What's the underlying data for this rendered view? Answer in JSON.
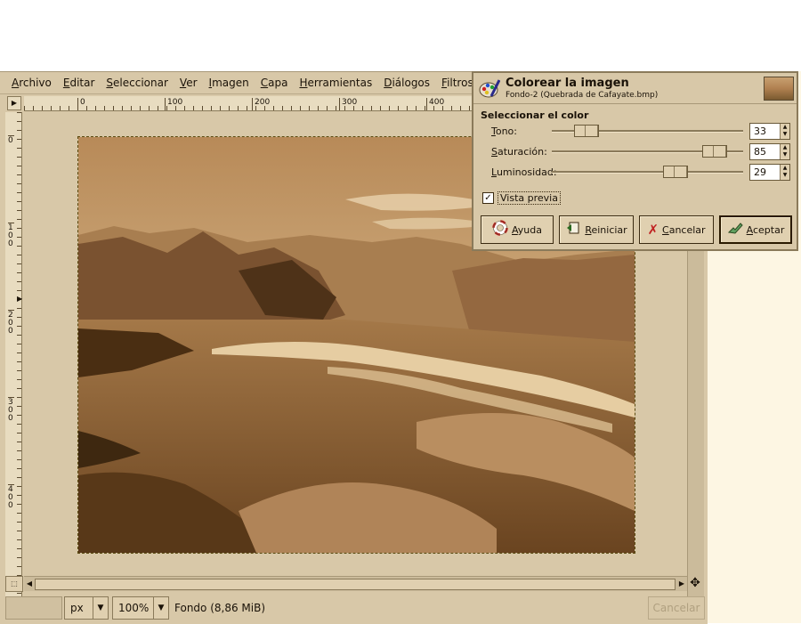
{
  "menubar": {
    "items": [
      "Archivo",
      "Editar",
      "Seleccionar",
      "Ver",
      "Imagen",
      "Capa",
      "Herramientas",
      "Diálogos",
      "Filtros"
    ]
  },
  "rulers": {
    "horizontal": [
      "0",
      "100",
      "200",
      "300",
      "400"
    ],
    "vertical": [
      "0",
      "100",
      "200",
      "300",
      "400"
    ]
  },
  "statusbar": {
    "unit": "px",
    "zoom": "100%",
    "message": "Fondo (8,86 MiB)",
    "cancel_label": "Cancelar"
  },
  "dialog": {
    "title": "Colorear la imagen",
    "subtitle": "Fondo-2 (Quebrada de Cafayate.bmp)",
    "section_title": "Seleccionar el color",
    "sliders": [
      {
        "label": "Tono:",
        "value": "33",
        "fraction": 0.18
      },
      {
        "label": "Saturación:",
        "value": "85",
        "fraction": 0.85
      },
      {
        "label": "Luminosidad:",
        "value": "29",
        "fraction": 0.645
      }
    ],
    "preview": {
      "label": "Vista previa",
      "checked": true
    },
    "buttons": {
      "help": "Ayuda",
      "reset": "Reiniciar",
      "cancel": "Cancelar",
      "ok": "Aceptar"
    }
  },
  "icons": {
    "dialog": "paint-palette-icon",
    "help": "lifebuoy-icon",
    "reset": "undo-icon",
    "cancel": "x-icon",
    "ok": "ok-hand-icon",
    "navigate": "move-cross-icon"
  },
  "colors": {
    "window_bg": "#d8c8a8",
    "sepia_dark": "#5a3a18",
    "sepia_light": "#e8d0a8"
  }
}
